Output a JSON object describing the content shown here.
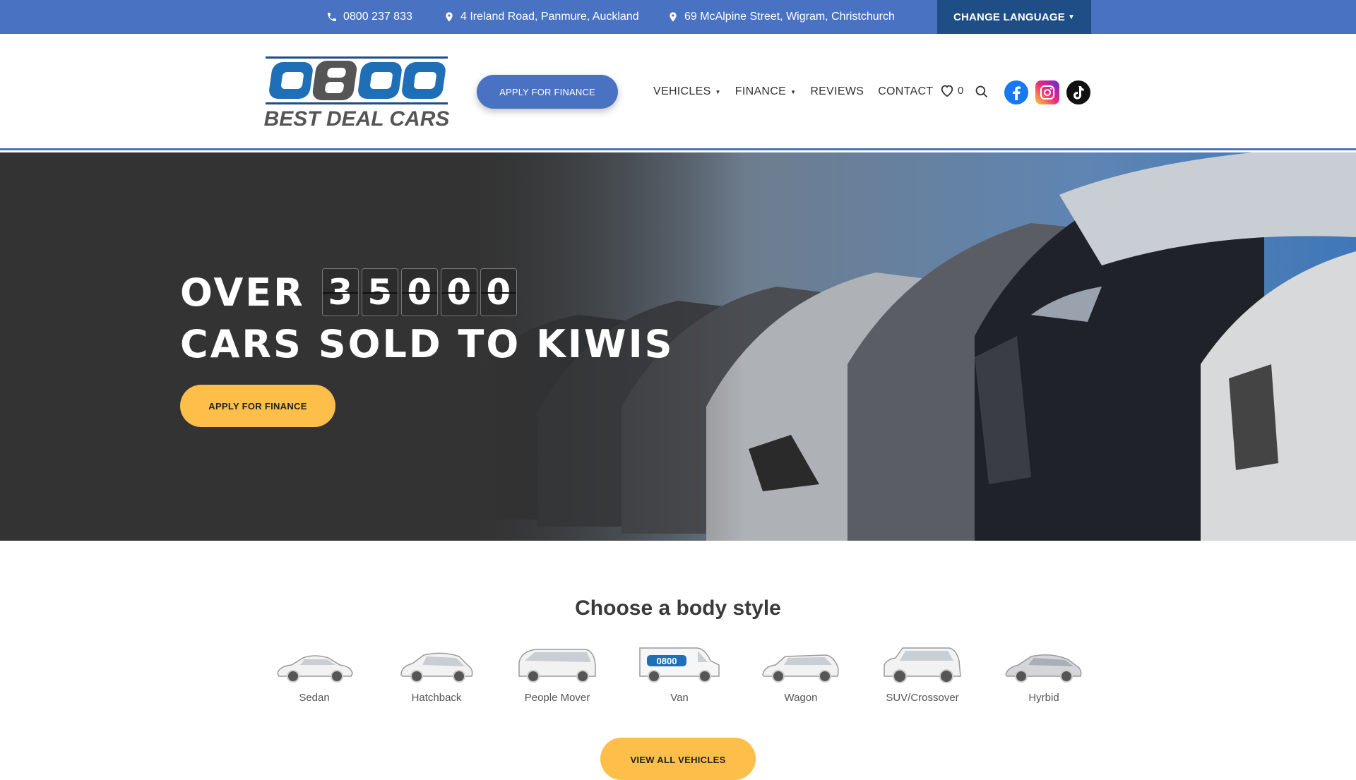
{
  "topbar": {
    "phone": "0800 237 833",
    "address_auckland": "4 Ireland Road, Panmure, Auckland",
    "address_christchurch": "69 McAlpine Street, Wigram, Christchurch",
    "language_label": "CHANGE LANGUAGE"
  },
  "header": {
    "logo_number": "0800",
    "logo_text": "BEST DEAL CARS",
    "finance_button": "APPLY FOR FINANCE",
    "nav": [
      {
        "label": "VEHICLES"
      },
      {
        "label": "FINANCE"
      },
      {
        "label": "REVIEWS"
      },
      {
        "label": "CONTACT"
      }
    ],
    "wishlist_count": "0",
    "social": [
      "facebook-icon",
      "instagram-icon",
      "tiktok-icon"
    ]
  },
  "hero": {
    "over": "OVER",
    "digits": [
      "3",
      "5",
      "0",
      "0",
      "0"
    ],
    "subline": "CARS SOLD TO KIWIS",
    "finance_button": "APPLY FOR FINANCE"
  },
  "body_styles": {
    "title": "Choose a body style",
    "items": [
      {
        "label": "Sedan"
      },
      {
        "label": "Hatchback"
      },
      {
        "label": "People Mover"
      },
      {
        "label": "Van",
        "van_badge": "0800"
      },
      {
        "label": "Wagon"
      },
      {
        "label": "SUV/Crossover"
      },
      {
        "label": "Hyrbid"
      }
    ],
    "view_all": "VIEW ALL VEHICLES"
  },
  "colors": {
    "brand_blue": "#4a72c2",
    "dark_blue": "#1f4d86",
    "accent_yellow": "#fdbf4a",
    "hero_bg": "#333333"
  }
}
